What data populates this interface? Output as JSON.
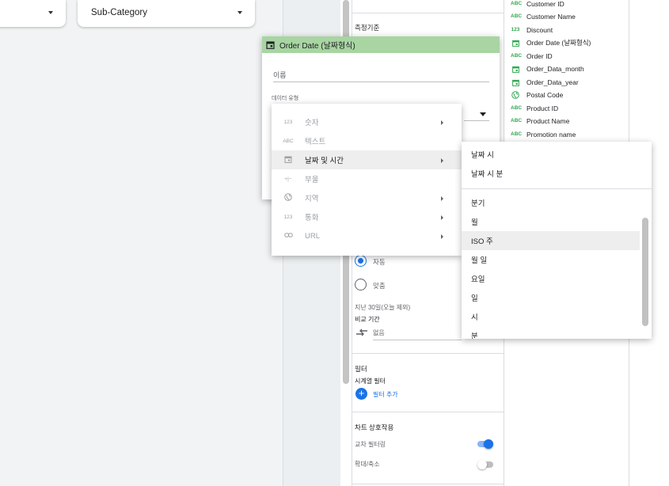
{
  "controls": [
    {
      "label": ""
    },
    {
      "label": "Sub-Category"
    }
  ],
  "properties": {
    "metric_label": "측정기준",
    "date_range": {
      "option_auto": "자동",
      "option_custom": "맞춤",
      "range_text": "지난 30일(오늘 제외)",
      "comparison_label": "비교 기간",
      "comparison_value": "없음"
    },
    "filter": {
      "title": "필터",
      "subtitle": "시계열 필터",
      "add_label": "필터 추가"
    },
    "interaction": {
      "title": "차트 상호작용",
      "cross_filter_label": "교차 필터링",
      "cross_filter_on": true,
      "zoom_label": "확대/축소",
      "zoom_on": false
    }
  },
  "fields": [
    {
      "type_text": "ABC",
      "name": "Customer ID",
      "icon": "text-icon"
    },
    {
      "type_text": "ABC",
      "name": "Customer Name",
      "icon": "text-icon"
    },
    {
      "type_text": "123",
      "name": "Discount",
      "icon": "number-icon"
    },
    {
      "type_text": "",
      "name": "Order Date (날짜형식)",
      "icon": "calendar-icon"
    },
    {
      "type_text": "ABC",
      "name": "Order ID",
      "icon": "text-icon"
    },
    {
      "type_text": "",
      "name": "Order_Data_month",
      "icon": "calendar-icon"
    },
    {
      "type_text": "",
      "name": "Order_Data_year",
      "icon": "calendar-icon"
    },
    {
      "type_text": "",
      "name": "Postal Code",
      "icon": "globe-icon"
    },
    {
      "type_text": "ABC",
      "name": "Product ID",
      "icon": "text-icon"
    },
    {
      "type_text": "ABC",
      "name": "Product Name",
      "icon": "text-icon"
    },
    {
      "type_text": "ABC",
      "name": "Promotion name",
      "icon": "text-icon"
    }
  ],
  "editor": {
    "title": "Order Date (날짜형식)",
    "name_placeholder": "이름",
    "data_type_label": "데이터 유형"
  },
  "type_menu": {
    "items": [
      {
        "label": "숫자",
        "icon_text": "123",
        "icon": "number-icon",
        "submenu": true,
        "highlighted": false
      },
      {
        "label": "텍스트",
        "icon_text": "ABC",
        "icon": "text-icon",
        "submenu": false,
        "highlighted": false
      },
      {
        "label": "날짜 및 시간",
        "icon_text": "",
        "icon": "calendar-icon",
        "submenu": true,
        "highlighted": true
      },
      {
        "label": "부울",
        "icon_text": "+|−",
        "icon": "boolean-icon",
        "submenu": false,
        "highlighted": false
      },
      {
        "label": "지역",
        "icon_text": "",
        "icon": "globe-icon",
        "submenu": true,
        "highlighted": false
      },
      {
        "label": "통화",
        "icon_text": "123",
        "icon": "currency-icon",
        "submenu": true,
        "highlighted": false
      },
      {
        "label": "URL",
        "icon_text": "",
        "icon": "link-icon",
        "submenu": true,
        "highlighted": false
      }
    ]
  },
  "date_submenu": {
    "items": [
      {
        "label": "날짜 시",
        "highlighted": false
      },
      {
        "label": "날짜 시 분",
        "highlighted": false
      },
      {
        "label": "분기",
        "highlighted": false
      },
      {
        "label": "월",
        "highlighted": false
      },
      {
        "label": "ISO 주",
        "highlighted": true
      },
      {
        "label": "월 일",
        "highlighted": false
      },
      {
        "label": "요일",
        "highlighted": false
      },
      {
        "label": "일",
        "highlighted": false
      },
      {
        "label": "시",
        "highlighted": false
      },
      {
        "label": "분",
        "highlighted": false
      }
    ]
  },
  "colors": {
    "accent_blue": "#1a73e8",
    "editor_header": "#a8d5a2",
    "field_icon_green": "#34a853"
  }
}
